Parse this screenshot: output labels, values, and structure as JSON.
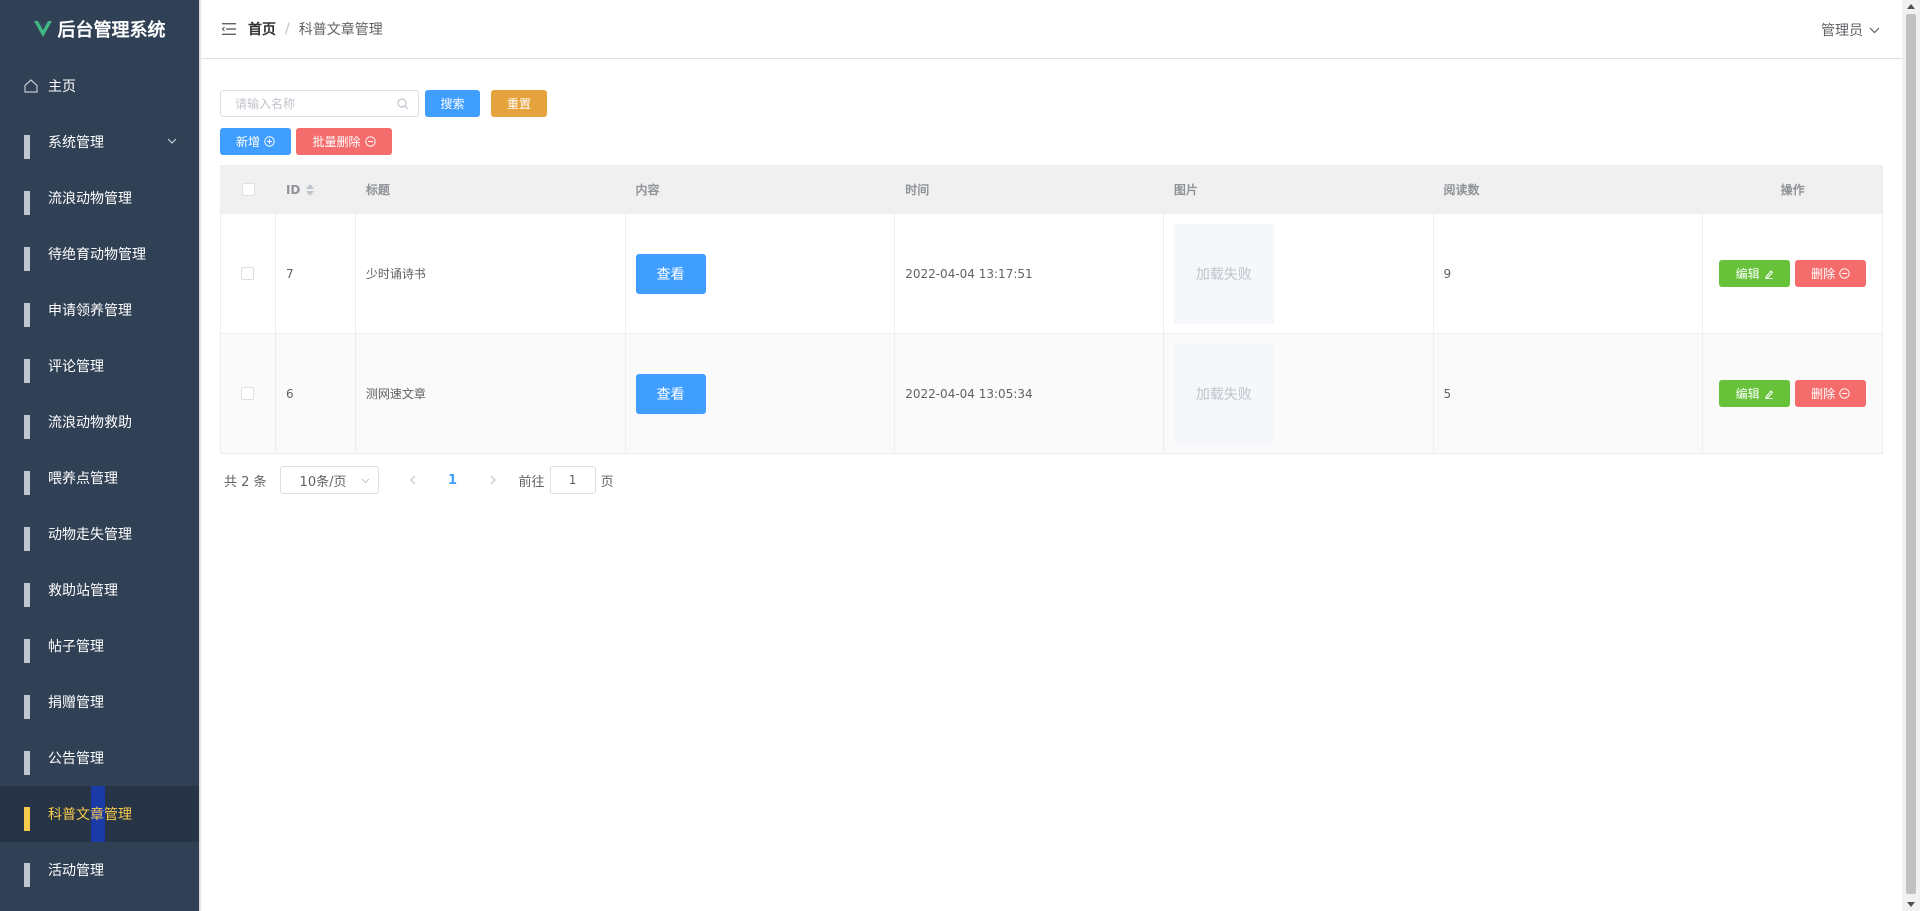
{
  "app": {
    "title": "后台管理系统",
    "logo_color": "#41b883"
  },
  "sidebar": {
    "items": [
      {
        "label": "主页",
        "icon": "home-icon"
      },
      {
        "label": "系统管理",
        "icon": "grid-icon",
        "expandable": true
      },
      {
        "label": "流浪动物管理",
        "icon": "grid-icon"
      },
      {
        "label": "待绝育动物管理",
        "icon": "grid-icon"
      },
      {
        "label": "申请领养管理",
        "icon": "grid-icon"
      },
      {
        "label": "评论管理",
        "icon": "grid-icon"
      },
      {
        "label": "流浪动物救助",
        "icon": "grid-icon"
      },
      {
        "label": "喂养点管理",
        "icon": "grid-icon"
      },
      {
        "label": "动物走失管理",
        "icon": "grid-icon"
      },
      {
        "label": "救助站管理",
        "icon": "grid-icon"
      },
      {
        "label": "帖子管理",
        "icon": "grid-icon"
      },
      {
        "label": "捐赠管理",
        "icon": "grid-icon"
      },
      {
        "label": "公告管理",
        "icon": "grid-icon"
      },
      {
        "label": "科普文章管理",
        "icon": "grid-icon",
        "active": true
      },
      {
        "label": "活动管理",
        "icon": "grid-icon"
      }
    ]
  },
  "header": {
    "breadcrumb": {
      "home": "首页",
      "separator": "/",
      "current": "科普文章管理"
    },
    "user": "管理员"
  },
  "toolbar": {
    "search_placeholder": "请输入名称",
    "search_label": "搜索",
    "reset_label": "重置",
    "add_label": "新增",
    "batch_delete_label": "批量删除"
  },
  "table": {
    "columns": {
      "id": "ID",
      "title": "标题",
      "content": "内容",
      "time": "时间",
      "image": "图片",
      "reads": "阅读数",
      "ops": "操作"
    },
    "rows": [
      {
        "id": "7",
        "title": "少时诵诗书",
        "content_btn": "查看",
        "time": "2022-04-04 13:17:51",
        "image": "加载失败",
        "reads": "9",
        "edit": "编辑",
        "delete": "删除"
      },
      {
        "id": "6",
        "title": "测网速文章",
        "content_btn": "查看",
        "time": "2022-04-04 13:05:34",
        "image": "加载失败",
        "reads": "5",
        "edit": "编辑",
        "delete": "删除"
      }
    ]
  },
  "pagination": {
    "total": "共 2 条",
    "page_size": "10条/页",
    "current_page": "1",
    "goto_label": "前往",
    "goto_value": "1",
    "goto_suffix": "页"
  },
  "colors": {
    "sidebar_bg": "#304156",
    "active_text": "#f6ca4d",
    "primary": "#409eff",
    "warning": "#e6a23c",
    "danger": "#f56c6c",
    "success": "#67c23a"
  }
}
